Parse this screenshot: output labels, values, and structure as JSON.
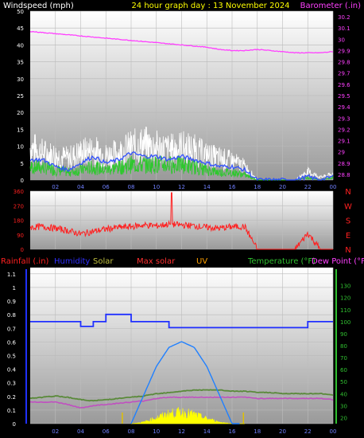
{
  "header": {
    "windspeed": "Windspeed (mph)",
    "title": "24 hour graph day : 13 November 2024",
    "barometer": "Barometer (.in)"
  },
  "legend": {
    "rainfall": "Rainfall (.in)",
    "humidity": "Humidity",
    "solar": "Solar",
    "max_solar": "Max solar",
    "uv": "UV",
    "temperature": "Temperature (°F)",
    "dew_point": "Dew Point (°F"
  },
  "colors": {
    "background": "#000000",
    "wind_gust": "#ffffff",
    "wind_avg": "#2ec82e",
    "wind_mean": "#3050ff",
    "barometer": "#ff40ff",
    "direction": "#ff2020",
    "humidity": "#2030ff",
    "solar": "#ffff00",
    "max_solar": "#2080ff",
    "temperature": "#5a8a3a",
    "dew_point": "#c050c0",
    "rain": "#a06060",
    "header_title": "#ffff00",
    "legend_humidity": "#3030ff",
    "legend_solar": "#c0c040",
    "legend_maxsolar": "#ff3030",
    "legend_uv": "#ffa000",
    "legend_temp": "#30c030",
    "legend_dew": "#ff40ff",
    "legend_rain": "#ff2020"
  },
  "x_ticks": [
    "02",
    "04",
    "06",
    "08",
    "10",
    "12",
    "14",
    "16",
    "18",
    "20",
    "22",
    "00"
  ],
  "chart_data": [
    {
      "type": "line",
      "title": "24 hour graph day : 13 November 2024",
      "ylabel": "Windspeed (mph)",
      "y2label": "Barometer (.in)",
      "ylim": [
        0,
        50
      ],
      "y2lim": [
        28.75,
        30.25
      ],
      "y_ticks": [
        0,
        5,
        10,
        15,
        20,
        25,
        30,
        35,
        40,
        45,
        50
      ],
      "y2_ticks": [
        "28.8",
        "28.9",
        "29",
        "29.1",
        "29.2",
        "29.3",
        "29.4",
        "29.5",
        "29.6",
        "29.7",
        "29.8",
        "29.9",
        "30",
        "30.1",
        "30.2"
      ],
      "x_hours": [
        0,
        1,
        2,
        3,
        4,
        5,
        6,
        7,
        8,
        9,
        10,
        11,
        12,
        13,
        14,
        15,
        16,
        17,
        18,
        19,
        20,
        21,
        22,
        23,
        24
      ],
      "series": [
        {
          "name": "gust",
          "values": [
            12,
            10,
            9,
            8,
            10,
            11,
            9,
            10,
            12,
            13,
            12,
            11,
            12,
            11,
            9,
            8,
            7,
            5,
            0,
            0,
            0,
            0,
            3,
            1,
            2
          ]
        },
        {
          "name": "average",
          "values": [
            5,
            5,
            4,
            3,
            4,
            5,
            4,
            5,
            6,
            6,
            6,
            6,
            6,
            5,
            4,
            3,
            3,
            2,
            0,
            0,
            0,
            0,
            1,
            0,
            1
          ]
        },
        {
          "name": "mean",
          "values": [
            6,
            6,
            4,
            3,
            5,
            7,
            5,
            6,
            8,
            7,
            7,
            6,
            7,
            6,
            5,
            4,
            4,
            3,
            0,
            0,
            0,
            0,
            1,
            0,
            1
          ]
        },
        {
          "name": "barometer",
          "values": [
            30.07,
            30.06,
            30.05,
            30.04,
            30.03,
            30.02,
            30.01,
            30.0,
            29.99,
            29.98,
            29.97,
            29.96,
            29.95,
            29.94,
            29.93,
            29.91,
            29.9,
            29.9,
            29.91,
            29.9,
            29.89,
            29.88,
            29.88,
            29.88,
            29.89
          ]
        }
      ]
    },
    {
      "type": "line",
      "ylabel": "Wind direction",
      "ylim": [
        0,
        360
      ],
      "y_ticks": [
        0,
        90,
        180,
        270,
        360
      ],
      "y_tick_labels": [
        "0",
        "90",
        "180",
        "270",
        "360"
      ],
      "compass": [
        "N",
        "W",
        "S",
        "E",
        "N"
      ],
      "x_hours": [
        0,
        1,
        2,
        3,
        4,
        5,
        6,
        7,
        8,
        9,
        10,
        11,
        12,
        13,
        14,
        15,
        16,
        17,
        18,
        19,
        20,
        21,
        22,
        23,
        24
      ],
      "series": [
        {
          "name": "direction",
          "values": [
            135,
            140,
            130,
            115,
            95,
            110,
            125,
            135,
            140,
            150,
            145,
            155,
            150,
            145,
            135,
            130,
            140,
            140,
            0,
            0,
            0,
            0,
            100,
            0,
            0
          ]
        }
      ]
    },
    {
      "type": "line",
      "ylim": [
        0,
        1.1
      ],
      "y_ticks": [
        0,
        0.1,
        0.2,
        0.3,
        0.4,
        0.5,
        0.6,
        0.7,
        0.8,
        0.9,
        1,
        1.1
      ],
      "y_tick_labels": [
        "0",
        "0.1",
        "0.2",
        "0.3",
        "0.4",
        "0.5",
        "0.6",
        "0.7",
        "0.8",
        "0.9",
        "1",
        "1.1"
      ],
      "y2lim": [
        15,
        145
      ],
      "y2_ticks": [
        20,
        30,
        40,
        50,
        60,
        70,
        80,
        90,
        100,
        110,
        120,
        130
      ],
      "x_hours": [
        0,
        1,
        2,
        3,
        4,
        5,
        6,
        7,
        8,
        9,
        10,
        11,
        12,
        13,
        14,
        15,
        16,
        17,
        18,
        19,
        20,
        21,
        22,
        23,
        24
      ],
      "series": [
        {
          "name": "humidity",
          "values": [
            100,
            100,
            100,
            100,
            96,
            100,
            106,
            106,
            100,
            100,
            100,
            95,
            95,
            95,
            95,
            95,
            95,
            95,
            95,
            95,
            95,
            95,
            100,
            100,
            100
          ]
        },
        {
          "name": "temperature",
          "values": [
            36,
            37,
            38,
            37,
            35,
            34,
            35,
            36,
            37,
            38,
            40,
            41,
            42,
            43,
            43,
            43,
            42,
            42,
            41,
            41,
            40,
            40,
            40,
            40,
            39
          ]
        },
        {
          "name": "dew_point",
          "values": [
            33,
            33,
            33,
            31,
            28,
            30,
            31,
            32,
            33,
            34,
            36,
            37,
            37,
            37,
            37,
            37,
            37,
            37,
            36,
            36,
            36,
            36,
            36,
            36,
            35
          ]
        },
        {
          "name": "max_solar",
          "values": [
            0,
            0,
            0,
            0,
            0,
            0,
            0,
            0,
            0,
            150,
            300,
            400,
            430,
            400,
            300,
            150,
            0,
            0,
            0,
            0,
            0,
            0,
            0,
            0,
            0
          ]
        },
        {
          "name": "solar",
          "values": [
            0,
            0,
            0,
            0,
            0,
            0,
            0,
            0,
            0,
            10,
            35,
            60,
            70,
            55,
            30,
            10,
            0,
            0,
            0,
            0,
            0,
            0,
            0,
            0,
            0
          ]
        },
        {
          "name": "rainfall",
          "values": [
            0,
            0,
            0,
            0,
            0,
            0,
            0,
            0,
            0,
            0,
            0,
            0,
            0,
            0,
            0,
            0,
            0,
            0,
            0,
            0,
            0,
            0,
            0,
            0,
            0
          ]
        }
      ]
    }
  ]
}
